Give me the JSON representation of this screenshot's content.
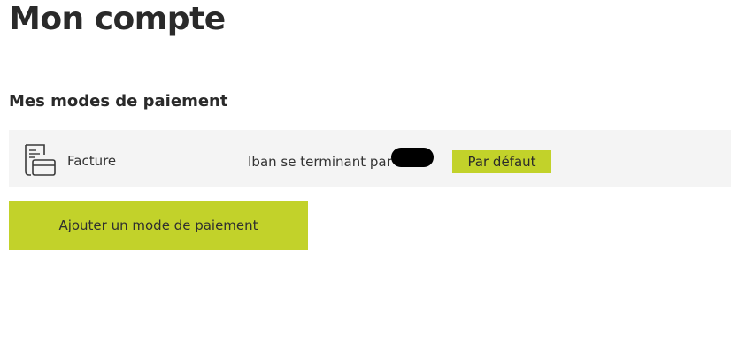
{
  "page": {
    "title": "Mon compte"
  },
  "payment_section": {
    "title": "Mes modes de paiement",
    "methods": [
      {
        "icon": "invoice-card-icon",
        "label": "Facture",
        "detail": "Iban se terminant par",
        "badge": "Par défaut"
      }
    ],
    "add_button_label": "Ajouter un mode de paiement"
  },
  "colors": {
    "accent": "#c2d22a",
    "row_background": "#f4f4f4",
    "text": "#2a2a2a"
  }
}
